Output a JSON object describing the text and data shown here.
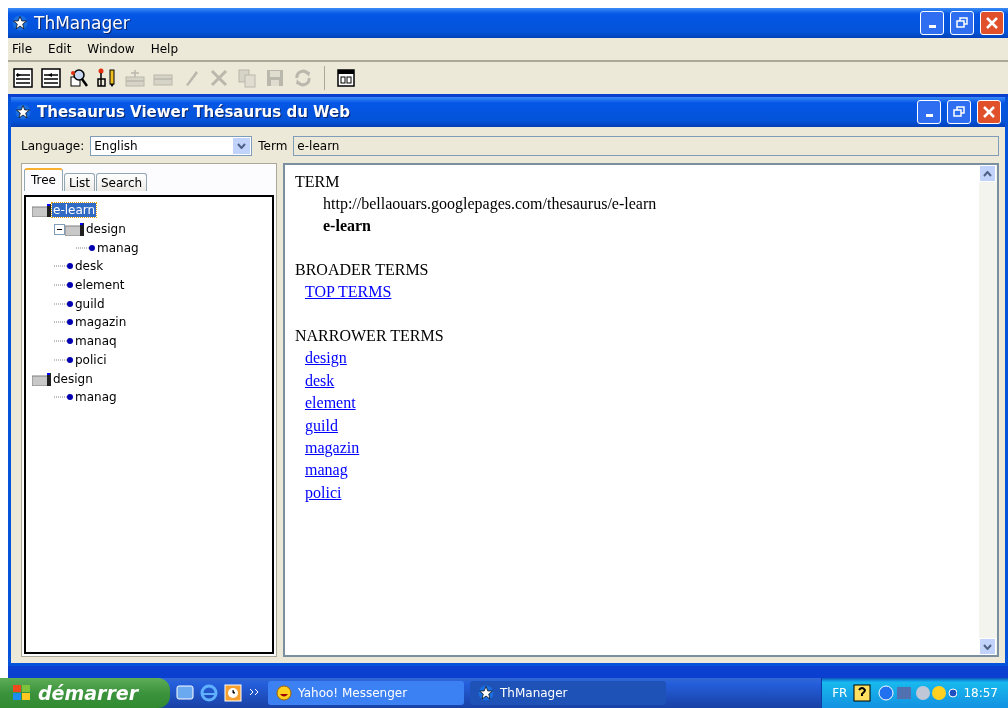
{
  "window": {
    "title": "ThManager"
  },
  "menu": [
    "File",
    "Edit",
    "Window",
    "Help"
  ],
  "toolbar": [
    {
      "kind": "indent",
      "disabled": false
    },
    {
      "kind": "outdent",
      "disabled": false
    },
    {
      "kind": "search",
      "disabled": false
    },
    {
      "kind": "tools",
      "disabled": false
    },
    {
      "kind": "addrow",
      "disabled": true
    },
    {
      "kind": "removerow",
      "disabled": true
    },
    {
      "kind": "pencil",
      "disabled": true
    },
    {
      "kind": "delete",
      "disabled": true
    },
    {
      "kind": "copy",
      "disabled": true
    },
    {
      "kind": "save",
      "disabled": true
    },
    {
      "kind": "refresh",
      "disabled": true
    }
  ],
  "toolbar_extra": [
    {
      "kind": "document",
      "disabled": false
    }
  ],
  "inner_window": {
    "title": "Thesaurus Viewer Thésaurus du Web"
  },
  "language": {
    "label": "Language:",
    "value": "English"
  },
  "term_field": {
    "label": "Term",
    "value": "e-learn"
  },
  "tabs": [
    {
      "label": "Tree",
      "selected": true
    },
    {
      "label": "List",
      "selected": false
    },
    {
      "label": "Search",
      "selected": false
    }
  ],
  "tree": [
    {
      "label": "e-learn",
      "kind": "folder",
      "selected": true,
      "children": [
        {
          "label": "design",
          "kind": "folder",
          "selected": false,
          "children": [
            {
              "label": "manag",
              "kind": "leaf",
              "selected": false
            }
          ]
        },
        {
          "label": "desk",
          "kind": "leaf",
          "selected": false
        },
        {
          "label": "element",
          "kind": "leaf",
          "selected": false
        },
        {
          "label": "guild",
          "kind": "leaf",
          "selected": false
        },
        {
          "label": "magazin",
          "kind": "leaf",
          "selected": false
        },
        {
          "label": "manaq",
          "kind": "leaf",
          "selected": false
        },
        {
          "label": "polici",
          "kind": "leaf",
          "selected": false
        }
      ]
    },
    {
      "label": "design",
      "kind": "folder",
      "selected": false,
      "children": [
        {
          "label": "manag",
          "kind": "leaf",
          "selected": false
        }
      ]
    }
  ],
  "content": {
    "term_heading": "TERM",
    "uri": "http://bellaouars.googlepages.com/thesaurus/e-learn",
    "term": "e-learn",
    "broader_heading": "BROADER TERMS",
    "broader": [
      "TOP TERMS"
    ],
    "narrower_heading": "NARROWER TERMS",
    "narrower": [
      "design",
      "desk",
      "element",
      "guild",
      "magazin",
      "manag",
      "polici"
    ]
  },
  "taskbar": {
    "start": "démarrer",
    "tasks": [
      {
        "label": "Yahoo! Messenger",
        "kind": "messenger",
        "selected": false
      },
      {
        "label": "ThManager",
        "kind": "app",
        "selected": true
      }
    ],
    "language": "FR",
    "clock": "18:57"
  }
}
